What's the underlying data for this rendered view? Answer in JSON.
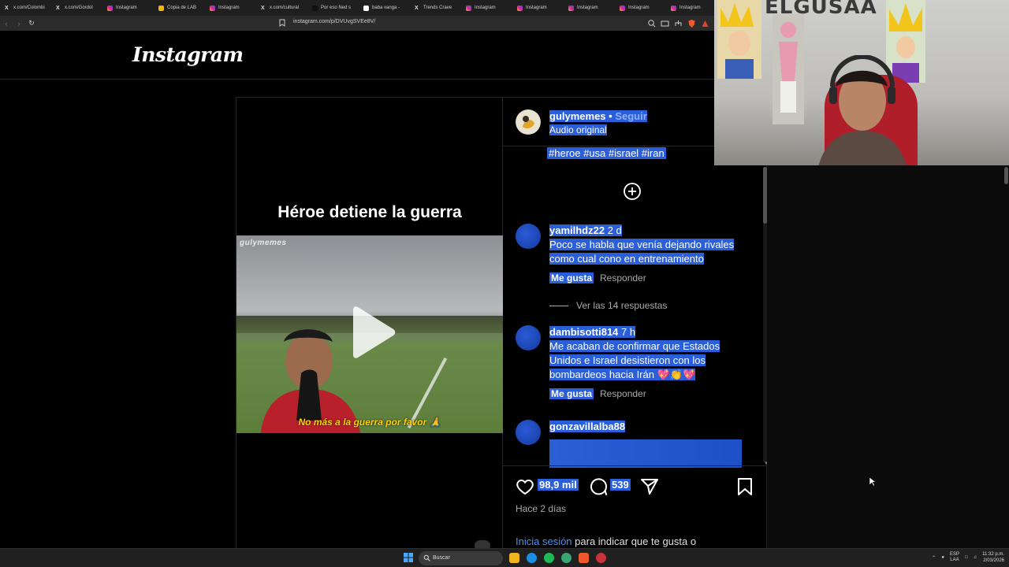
{
  "browser": {
    "tabs": [
      {
        "label": "x.com/Colombi",
        "icon": "x-icon"
      },
      {
        "label": "x.com/Gordol",
        "icon": "x-icon"
      },
      {
        "label": "Instagram",
        "icon": "instagram-icon"
      },
      {
        "label": "Copia de LAB",
        "icon": "link-icon"
      },
      {
        "label": "Instagram",
        "icon": "instagram-icon"
      },
      {
        "label": "x.com/cultural",
        "icon": "x-icon"
      },
      {
        "label": "Por eso Ned s",
        "icon": "tiktok-icon"
      },
      {
        "label": "baba vanga -",
        "icon": "google-icon"
      },
      {
        "label": "Trends Crave",
        "icon": "x-icon"
      },
      {
        "label": "Instagram",
        "icon": "instagram-icon"
      },
      {
        "label": "Instagram",
        "icon": "instagram-icon"
      },
      {
        "label": "Instagram",
        "icon": "instagram-icon"
      },
      {
        "label": "Instagram",
        "icon": "instagram-icon"
      },
      {
        "label": "Instagram",
        "icon": "instagram-icon"
      }
    ],
    "url": "instagram.com/p/DVUvgSVEe8V/"
  },
  "instagram": {
    "logo": "Instagram",
    "post": {
      "media_title": "Héroe detiene la guerra",
      "watermark": "gulymemes",
      "subtitle": "No más a la guerra por favor 🙏",
      "owner": {
        "username": "gulymemes",
        "separator": " • ",
        "follow": "Seguir",
        "audio": "Audio original"
      },
      "caption": "#heroe #usa #israel #iran",
      "comments": [
        {
          "user": "yamilhdz22",
          "time": "2 d",
          "text": "Poco se habla que venía dejando rivales como cual cono en entrenamiento",
          "like": "Me gusta",
          "reply": "Responder",
          "view_replies": "Ver las 14 respuestas"
        },
        {
          "user": "dambisotti814",
          "time": "7 h",
          "text": "Me acaban de confirmar que Estados Unidos e Israel desistieron con los bombardeos hacia Irán 💖👏💖",
          "like": "Me gusta",
          "reply": "Responder"
        },
        {
          "user": "gonzavillalba88"
        }
      ],
      "likes": "98,9 mil",
      "comment_count": "539",
      "date": "Hace 2 días",
      "login_link": "Inicia sesión",
      "login_rest": " para indicar que te gusta o"
    }
  },
  "webcam": {
    "banner": "ELGUSAA"
  },
  "taskbar": {
    "search": "Buscar",
    "lang_top": "ESP",
    "lang_bottom": "LAA",
    "time": "11:32 p.m.",
    "date": "2/03/2026"
  },
  "colors": {
    "selection": "#2b5fd9",
    "link": "#4b8ef7",
    "follow": "#8fb0ff"
  }
}
